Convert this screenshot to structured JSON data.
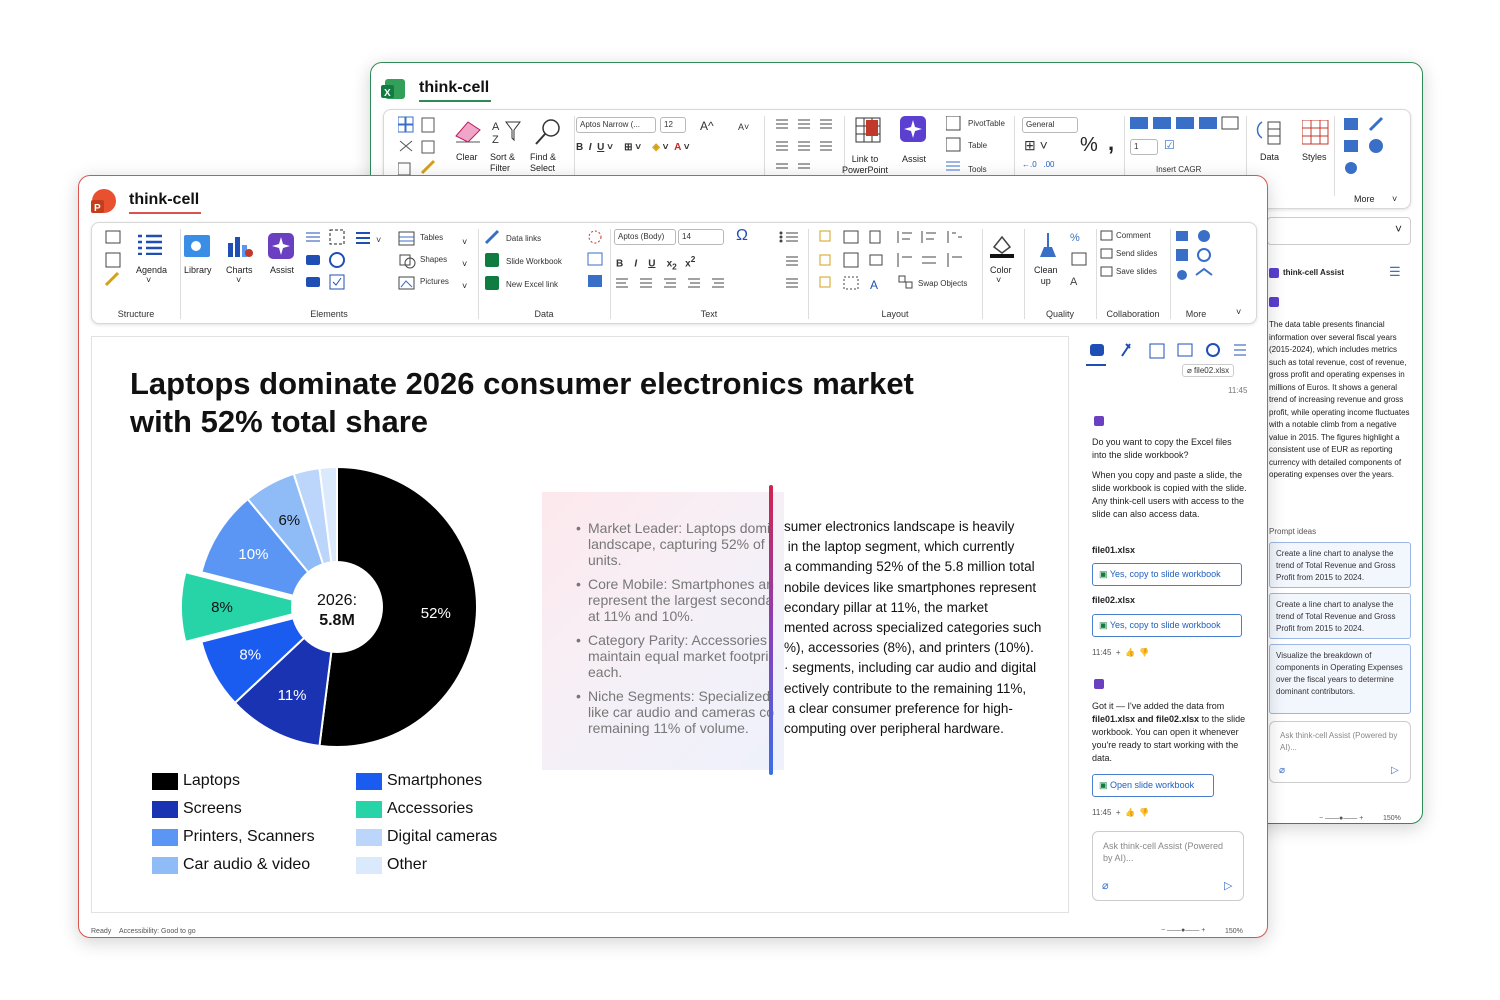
{
  "excel": {
    "brand": "think-cell",
    "ribbon": {
      "clear": "Clear",
      "sort_filter": [
        "Sort &",
        "Filter"
      ],
      "find_select": [
        "Find &",
        "Select"
      ],
      "font_name": "Aptos Narrow (...",
      "font_size": "12",
      "link_powerpoint": [
        "Link to",
        "PowerPoint"
      ],
      "assist": "Assist",
      "pivot_table": "PivotTable",
      "table": "Table",
      "tools": "Tools",
      "number_format": "General",
      "stepper_value": "1",
      "insert_cagr": "Insert CAGR",
      "data": "Data",
      "styles": "Styles",
      "more": "More"
    },
    "assist": {
      "title": "think-cell Assist",
      "summary": "The data table presents financial information over several fiscal years (2015-2024), which includes metrics such as total revenue, cost of revenue, gross profit and operating expenses in millions of Euros. It shows a general trend of increasing revenue and gross profit, while operating income fluctuates with a notable climb from a negative value in 2015. The figures highlight a consistent use of EUR as reporting currency with detailed components of operating expenses over the years.",
      "prompt_ideas_label": "Prompt ideas",
      "prompts": [
        "Create a line chart to analyse the trend of Total Revenue and Gross Profit from 2015 to 2024.",
        "Create a line chart to analyse the trend of Total Revenue and Gross Profit from 2015 to 2024.",
        "Visualize the breakdown of components in Operating Expenses over the fiscal years to determine dominant contributors."
      ],
      "input_placeholder": "Ask think-cell Assist (Powered by AI)..."
    },
    "zoom": "150%"
  },
  "ppt": {
    "brand": "think-cell",
    "ribbon": {
      "agenda": "Agenda",
      "library": "Library",
      "charts": "Charts",
      "assist": "Assist",
      "tables": "Tables",
      "shapes": "Shapes",
      "pictures": "Pictures",
      "data_links": "Data links",
      "slide_workbook": "Slide Workbook",
      "new_excel_link": "New Excel link",
      "font_name": "Aptos (Body)",
      "font_size": "14",
      "swap_objects": "Swap Objects",
      "color": "Color",
      "clean_up": [
        "Clean",
        "up"
      ],
      "comment": "Comment",
      "send_slides": "Send slides",
      "save_slides": "Save slides",
      "groups": [
        "Structure",
        "Elements",
        "Data",
        "Text",
        "Layout",
        "Quality",
        "Collaboration",
        "More"
      ]
    },
    "slide": {
      "title_line1": "Laptops dominate 2026 consumer electronics market",
      "title_line2": "with 52% total share",
      "bullets": [
        [
          "Market Leader: Laptops domi",
          "landscape, capturing 52% of t",
          "units."
        ],
        [
          "Core Mobile: Smartphones an",
          "represent the largest seconda",
          "at 11% and 10%."
        ],
        [
          "Category Parity: Accessories",
          "maintain equal market footpri",
          "each."
        ],
        [
          "Niche Segments: Specialized",
          "like car audio and cameras co",
          "remaining 11% of volume."
        ]
      ],
      "body_lines": [
        "sumer electronics landscape is heavily",
        " in the laptop segment, which currently",
        "a commanding 52% of the 5.8 million total",
        "nobile devices like smartphones represent",
        "econdary pillar at 11%, the market",
        "mented across specialized categories such",
        "%), accessories (8%), and printers (10%).",
        "· segments, including car audio and digital",
        "ectively contribute to the remaining 11%,",
        " a clear consumer preference for high-",
        "computing over peripheral hardware."
      ]
    },
    "assist": {
      "attachment": "file02.xlsx",
      "time1": "11:45",
      "question": "Do you want to copy the Excel files into the slide workbook?",
      "explain": "When you copy and paste a slide, the slide workbook is copied with the slide. Any think-cell users with access to the slide can also access data.",
      "file1": "file01.xlsx",
      "file2": "file02.xlsx",
      "yes_label": "Yes, copy to slide workbook",
      "time2": "11:45",
      "reply_pre": "Got it — I've added the data from ",
      "reply_bold": "file01.xlsx and file02.xlsx",
      "reply_post": " to the slide workbook. You can open it whenever you're ready to start working with the data.",
      "open_label": "Open slide workbook",
      "time3": "11:45",
      "input_placeholder": "Ask think-cell Assist (Powered by AI)..."
    },
    "status": {
      "ready": "Ready",
      "accessibility": "Accessibility: Good to go",
      "zoom": "150%"
    }
  },
  "chart_data": {
    "type": "pie",
    "center_label_line1": "2026:",
    "center_label_line2": "5.8M",
    "slices": [
      {
        "name": "Laptops",
        "value": 52,
        "label": "52%",
        "color": "#000000",
        "exploded": false
      },
      {
        "name": "Screens",
        "value": 11,
        "label": "11%",
        "color": "#1a33b3",
        "exploded": false
      },
      {
        "name": "Smartphones",
        "value": 8,
        "label": "8%",
        "color": "#1a5cf0",
        "exploded": false
      },
      {
        "name": "Accessories",
        "value": 8,
        "label": "8%",
        "color": "#26d4a8",
        "exploded": true
      },
      {
        "name": "Printers, Scanners",
        "value": 10,
        "label": "10%",
        "color": "#5b96f5",
        "exploded": false
      },
      {
        "name": "Car audio & video",
        "value": 6,
        "label": "6%",
        "color": "#8fbcf7",
        "exploded": false
      },
      {
        "name": "Digital cameras",
        "value": 3,
        "label": "",
        "color": "#bcd6fb",
        "exploded": false
      },
      {
        "name": "Other",
        "value": 2,
        "label": "",
        "color": "#dbe9fd",
        "exploded": false
      }
    ],
    "legend": [
      {
        "name": "Laptops",
        "color": "#000000"
      },
      {
        "name": "Smartphones",
        "color": "#1a5cf0"
      },
      {
        "name": "Screens",
        "color": "#1a33b3"
      },
      {
        "name": "Accessories",
        "color": "#26d4a8"
      },
      {
        "name": "Printers, Scanners",
        "color": "#5b96f5"
      },
      {
        "name": "Digital cameras",
        "color": "#bcd6fb"
      },
      {
        "name": "Car audio & video",
        "color": "#8fbcf7"
      },
      {
        "name": "Other",
        "color": "#dbe9fd"
      }
    ]
  }
}
